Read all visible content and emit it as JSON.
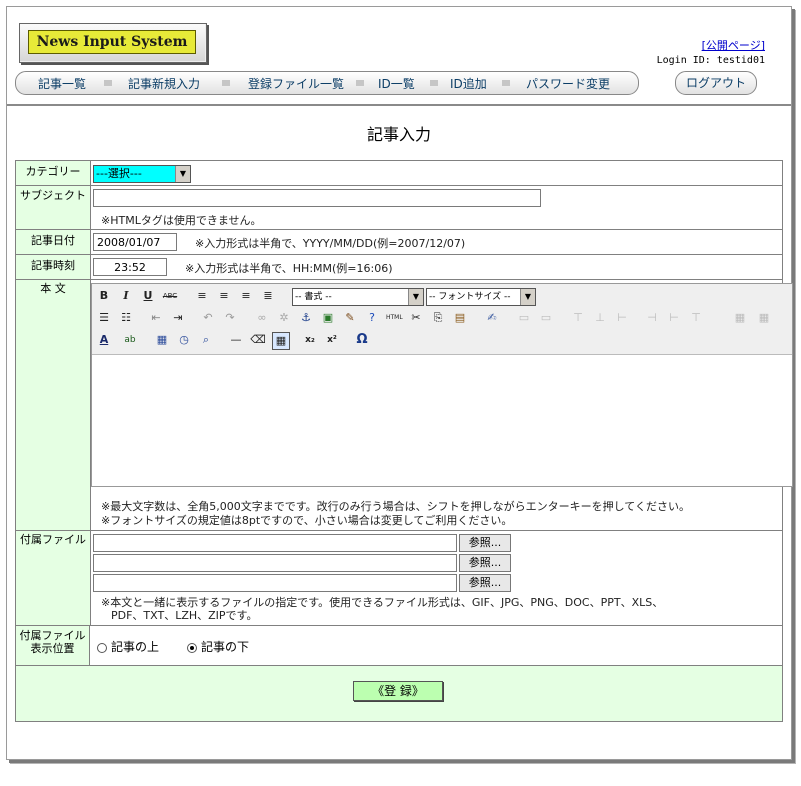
{
  "header": {
    "logo_text": "News Input System",
    "public_link": "[公開ページ]",
    "login_id": "Login ID: testid01",
    "logout": "ログアウト"
  },
  "nav": {
    "items": [
      "記事一覧",
      "記事新規入力",
      "登録ファイル一覧",
      "ID一覧",
      "ID追加",
      "パスワード変更"
    ]
  },
  "page": {
    "title": "記事入力"
  },
  "form": {
    "category": {
      "label": "カテゴリー",
      "selected": "---選択---"
    },
    "subject": {
      "label": "サブジェクト",
      "value": "",
      "note": "※HTMLタグは使用できません。"
    },
    "date": {
      "label": "記事日付",
      "value": "2008/01/07",
      "note": "※入力形式は半角で、YYYY/MM/DD(例=2007/12/07)"
    },
    "time": {
      "label": "記事時刻",
      "value": "23:52",
      "note": "※入力形式は半角で、HH:MM(例=16:06)"
    },
    "body": {
      "label": "本 文",
      "format_select": "-- 書式 --",
      "fontsize_select": "-- フォントサイズ --",
      "note1": "※最大文字数は、全角5,000文字までです。改行のみ行う場合は、シフトを押しながらエンターキーを押してください。",
      "note2": "※フォントサイズの規定値は8ptですので、小さい場合は変更してご利用ください。"
    },
    "attachments": {
      "label": "付属ファイル",
      "browse": "参照...",
      "note1": "※本文と一緒に表示するファイルの指定です。使用できるファイル形式は、GIF、JPG、PNG、DOC、PPT、XLS、",
      "note2": "PDF、TXT、LZH、ZIPです。"
    },
    "position": {
      "label1": "付属ファイル",
      "label2": "表示位置",
      "option_above": "記事の上",
      "option_below": "記事の下",
      "selected": "記事の下"
    },
    "submit": "《登 録》"
  },
  "toolbar_icons": {
    "row1": [
      "bold-icon",
      "italic-icon",
      "underline-icon",
      "strikethrough-icon",
      "align-left-icon",
      "align-center-icon",
      "align-right-icon",
      "align-justify-icon"
    ],
    "row2": [
      "bullet-list-icon",
      "numbered-list-icon",
      "outdent-icon",
      "indent-icon",
      "undo-icon",
      "redo-icon",
      "link-icon",
      "unlink-icon",
      "anchor-icon",
      "image-icon",
      "cleanup-icon",
      "help-icon",
      "html-icon",
      "cut-icon",
      "copy-icon",
      "paste-icon",
      "edit-icon"
    ],
    "row3": [
      "font-color-icon",
      "highlight-icon",
      "insert-date-icon",
      "insert-time-icon",
      "preview-icon",
      "horizontal-rule-icon",
      "remove-format-icon",
      "visual-aid-icon",
      "subscript-icon",
      "superscript-icon",
      "special-char-icon"
    ]
  },
  "colors": {
    "label_bg": "#e5ffe3",
    "submit_bg": "#bcffb0",
    "select_bg": "#00ffff",
    "logo_bg": "#e7ea38"
  }
}
